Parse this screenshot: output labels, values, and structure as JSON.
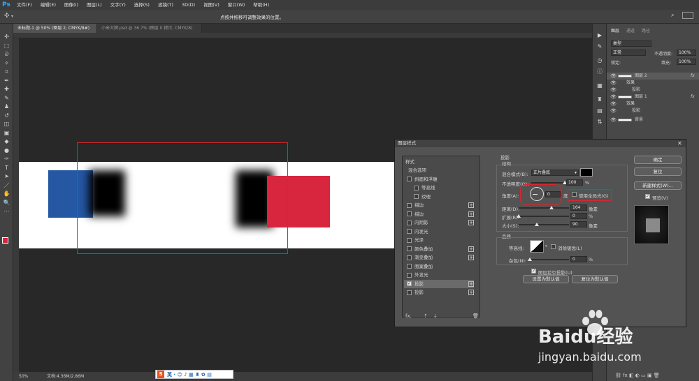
{
  "app": {
    "logo": "Ps"
  },
  "menu": [
    "文件(F)",
    "编辑(E)",
    "图像(I)",
    "图层(L)",
    "文字(Y)",
    "选择(S)",
    "滤镜(T)",
    "3D(D)",
    "视图(V)",
    "窗口(W)",
    "帮助(H)"
  ],
  "hint": "点按并拖移可调整效果的位置。",
  "tabs": [
    {
      "label": "未标题-1 @ 50% (图层 2, CMYK/8#) *"
    },
    {
      "label": "小米大牌.psd @ 36.7% (图层 0 拷贝, CMYK/8)"
    }
  ],
  "status": {
    "zoom": "50%",
    "doc": "文档:4.36M/2.86M"
  },
  "layers_panel": {
    "tabs": [
      "图层",
      "通道",
      "路径"
    ],
    "search": "类型",
    "blend": "正常",
    "opacity_label": "不透明度:",
    "opacity": "100%",
    "lock_label": "锁定:",
    "fill_label": "填充:",
    "fill": "100%",
    "rows": [
      {
        "name": "图层 2",
        "fx": "fx"
      },
      {
        "name": "效果"
      },
      {
        "name": "投影"
      },
      {
        "name": "图层 1",
        "fx": "fx"
      },
      {
        "name": "效果"
      },
      {
        "name": "投影"
      },
      {
        "name": "背景"
      }
    ]
  },
  "dialog": {
    "title": "图层样式",
    "styles_header": "样式",
    "styles": [
      {
        "label": "混合选项",
        "check": false,
        "plus": false,
        "indent": 0
      },
      {
        "label": "斜面和浮雕",
        "check": true,
        "checked": false,
        "plus": false,
        "indent": 0
      },
      {
        "label": "等高线",
        "check": true,
        "checked": false,
        "plus": false,
        "indent": 1
      },
      {
        "label": "纹理",
        "check": true,
        "checked": false,
        "plus": false,
        "indent": 1
      },
      {
        "label": "描边",
        "check": true,
        "checked": false,
        "plus": true,
        "indent": 0
      },
      {
        "label": "描边",
        "check": true,
        "checked": false,
        "plus": true,
        "indent": 0
      },
      {
        "label": "内阴影",
        "check": true,
        "checked": false,
        "plus": true,
        "indent": 0
      },
      {
        "label": "内发光",
        "check": true,
        "checked": false,
        "plus": false,
        "indent": 0
      },
      {
        "label": "光泽",
        "check": true,
        "checked": false,
        "plus": false,
        "indent": 0
      },
      {
        "label": "颜色叠加",
        "check": true,
        "checked": false,
        "plus": true,
        "indent": 0
      },
      {
        "label": "渐变叠加",
        "check": true,
        "checked": false,
        "plus": true,
        "indent": 0
      },
      {
        "label": "图案叠加",
        "check": true,
        "checked": false,
        "plus": false,
        "indent": 0
      },
      {
        "label": "外发光",
        "check": true,
        "checked": false,
        "plus": false,
        "indent": 0
      },
      {
        "label": "投影",
        "check": true,
        "checked": true,
        "plus": true,
        "indent": 0,
        "selected": true
      },
      {
        "label": "投影",
        "check": true,
        "checked": false,
        "plus": true,
        "indent": 0
      }
    ],
    "section_title": "投影",
    "structure_title": "结构",
    "blend_mode_label": "混合模式(B):",
    "blend_mode": "正片叠底",
    "opacity_label": "不透明度(O):",
    "opacity_value": "100",
    "opacity_fraction": 1.0,
    "angle_label": "角度(A):",
    "angle_value": "0",
    "degree_unit": "度",
    "global_light": "使用全局光(G)",
    "distance_label": "距离(D):",
    "distance_value": "164",
    "distance_fraction": 0.65,
    "spread_label": "扩展(R):",
    "spread_value": "0",
    "spread_fraction": 0.0,
    "size_label": "大小(S):",
    "size_value": "90",
    "size_fraction": 0.36,
    "unit_px": "像素",
    "unit_pct": "%",
    "quality_title": "品质",
    "contour_label": "等高线:",
    "antialias": "消除锯齿(L)",
    "noise_label": "杂色(N):",
    "noise_value": "0",
    "noise_fraction": 0.0,
    "knockout": "图层挖空投影(U)",
    "make_default": "设置为默认值",
    "reset_default": "复位为默认值",
    "ok": "确定",
    "reset": "复位",
    "new_style": "新建样式(W)...",
    "preview": "预览(V)",
    "fx": "fx."
  },
  "colors": {
    "blue": "#2557a3",
    "red": "#d9263f",
    "highlight": "#d9262c"
  },
  "watermark": {
    "brand": "Baidu经验",
    "url": "jingyan.baidu.com"
  }
}
